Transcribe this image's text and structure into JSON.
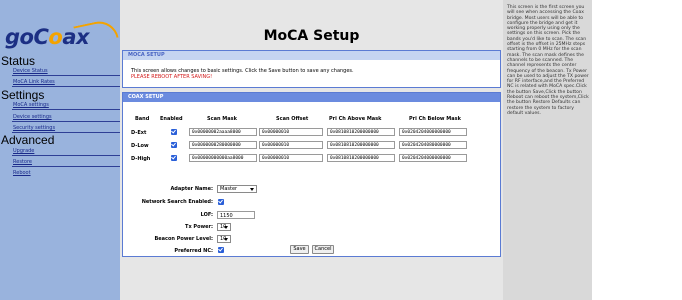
{
  "logo": {
    "text_before": "goC",
    "text_o": "o",
    "text_after": "ax"
  },
  "sidebar": {
    "sections": [
      {
        "title": "Status",
        "links": [
          "Device Status",
          "MoCA Link Rates"
        ]
      },
      {
        "title": "Settings",
        "links": [
          "MoCA settings",
          "Device settings",
          "Security settings"
        ]
      },
      {
        "title": "Advanced",
        "links": [
          "Upgrade",
          "Restore",
          "Reboot"
        ]
      }
    ]
  },
  "page": {
    "title": "MoCA Setup"
  },
  "moca_setup": {
    "header": "MOCA SETUP",
    "info": "This screen allows changes to basic settings. Click the Save button to save any changes.",
    "warning": "PLEASE REBOOT AFTER SAVING!"
  },
  "coax_setup": {
    "header": "COAX SETUP",
    "columns": [
      "Band",
      "Enabled",
      "Scan Mask",
      "Scan Offset",
      "Pri Ch Above Mask",
      "Pri Ch Below Mask"
    ],
    "rows": [
      {
        "band": "D-Ext",
        "enabled": true,
        "scan_mask": "0x00000002aaaa8000",
        "scan_offset": "0x00000010",
        "above": "0x0810810200000000",
        "below": "0x0204204000000000"
      },
      {
        "band": "D-Low",
        "enabled": true,
        "scan_mask": "0x0000000280000000",
        "scan_offset": "0x00000010",
        "above": "0x0810810200000000",
        "below": "0x0204204080000000"
      },
      {
        "band": "D-High",
        "enabled": true,
        "scan_mask": "0x00000000000aa8000",
        "scan_offset": "0x00000010",
        "above": "0x0810810200000000",
        "below": "0x0204204000000000"
      }
    ],
    "fields": {
      "adapter_name_label": "Adapter Name:",
      "adapter_name_value": "Master",
      "network_search_label": "Network Search Enabled:",
      "network_search_checked": true,
      "lof_label": "LOF:",
      "lof_value": "1150",
      "tx_power_label": "Tx Power:",
      "tx_power_value": "10",
      "beacon_power_label": "Beacon Power Level:",
      "beacon_power_value": "10",
      "preferred_nc_label": "Preferred NC:",
      "preferred_nc_checked": true
    },
    "save_label": "Save",
    "cancel_label": "Cancel"
  },
  "help_text": "This screen is the first screen you will see when accessing the Coax bridge. Most users will be able to configure the bridge and get it working properly using only the settings on this screen. Pick the bands you'd like to scan. The scan offset is the offset in 25MHz steps starting from 0 MHz for the scan mask. The scan mask defines the channels to be scanned. The channel represents the center frequency of the beacon. Tx Power can be used to adjust the TX power for RF interface,and the Preferred NC is related with MoCA spec.Click the button Save,Click the button Reboot can reboot the system,Click the button Restore Defaults can restore the system to factory default values.",
  "colors": {
    "sidebar": "#99b3dd",
    "panel_border": "#5b7bd3",
    "coax_header": "#6b8bdf",
    "checkbox": "#2a5fd8",
    "warning": "#d21a1a"
  }
}
